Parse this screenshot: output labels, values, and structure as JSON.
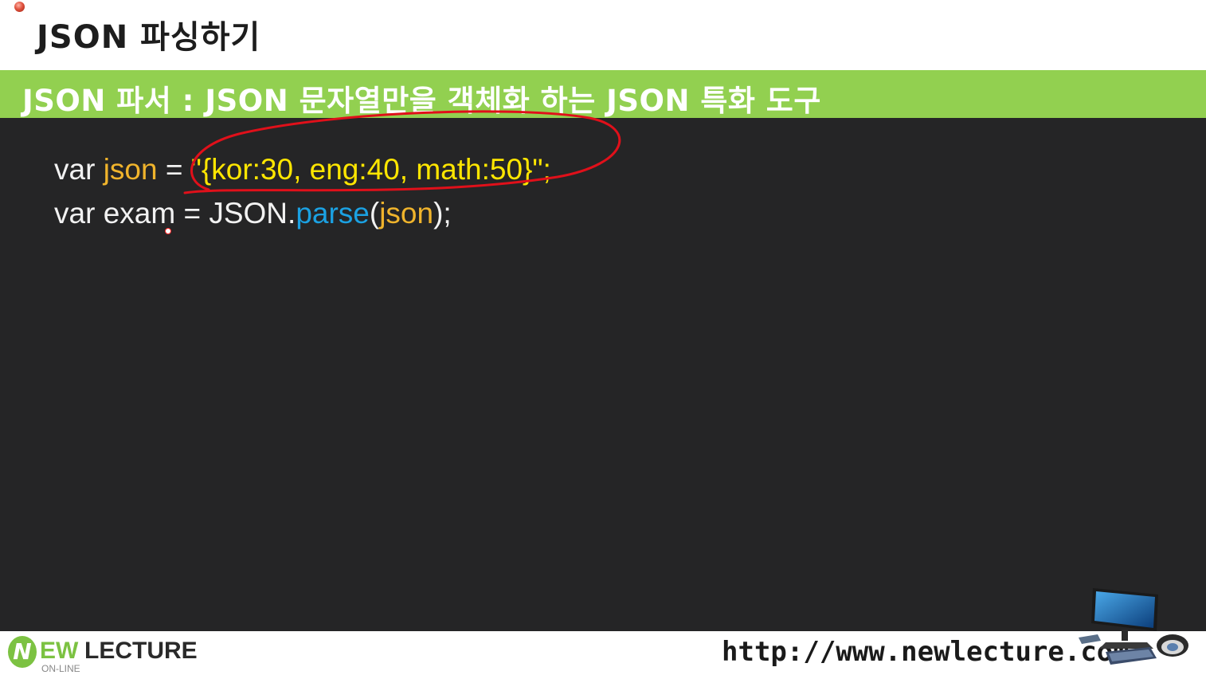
{
  "slide": {
    "title": "JSON 파싱하기",
    "subtitle": "JSON 파서 : JSON 문자열만을 객체화 하는 JSON 특화 도구"
  },
  "code": {
    "line1": {
      "kw": "var",
      "ident": "json",
      "op": "=",
      "value": "\"{kor:30, eng:40, math:50}\";"
    },
    "line2": {
      "kw": "var",
      "ident": "exam",
      "op": "=",
      "obj": "JSON.",
      "fn": "parse",
      "open": "(",
      "arg": "json",
      "close": ");"
    }
  },
  "footer": {
    "logo_n": "N",
    "logo_ew": "EW",
    "logo_lecture": "LECTURE",
    "logo_online": "ON-LINE",
    "url": "http://www.newlecture.com"
  },
  "colors": {
    "subtitle_bar": "#92d050",
    "code_background": "#252526",
    "identifier": "#f0b42c",
    "string": "#ffe600",
    "function": "#1ba1e2",
    "annotation": "#e0101a"
  },
  "icons": {
    "corner": "red-dot-icon",
    "illustration": "computer-illustration-icon"
  }
}
